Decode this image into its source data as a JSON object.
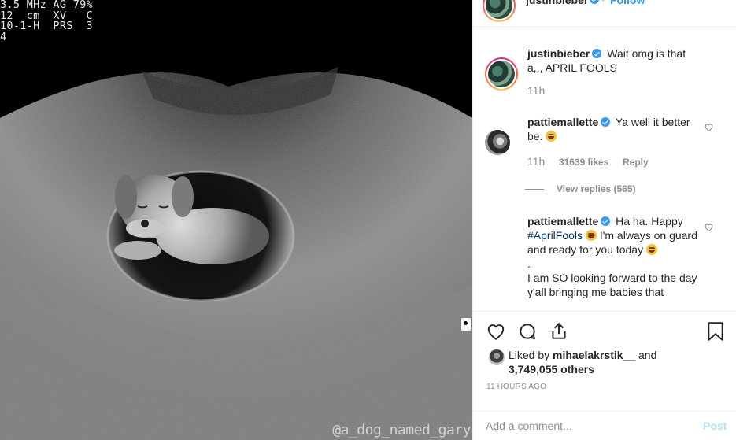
{
  "media": {
    "readout": "3.5 MHz AG 79%\n12  cm  XV   C\n10-1-H  PRS  3\n4",
    "watermark": "@a_dog_named_gary"
  },
  "header": {
    "username": "justinbieber",
    "dot": "•",
    "follow_label": "Follow"
  },
  "comments": [
    {
      "username": "justinbieber",
      "text": "Wait omg is that a,,, APRIL FOOLS",
      "time": "11h"
    },
    {
      "username": "pattiemallette",
      "text": "Ya well it better be.",
      "time": "11h",
      "likes": "31639 likes",
      "reply_label": "Reply",
      "view_replies": "View replies (565)"
    },
    {
      "username": "pattiemallette",
      "text_a": "Ha ha. Happy",
      "hashtag": "#AprilFools",
      "text_b": "I'm always on guard and ready for you today",
      "text_c": ".",
      "text_d": "I am SO looking forward to the day y'all bringing me babies that"
    }
  ],
  "likes": {
    "prefix": "Liked by",
    "user": "mihaelakrstik__",
    "and": "and",
    "count": "3,749,055 others"
  },
  "timestamp": "11 HOURS AGO",
  "add_comment": {
    "placeholder": "Add a comment...",
    "post_label": "Post"
  },
  "colors": {
    "accent": "#3897f0",
    "post_disabled": "#b2dffc",
    "hashtag": "#003569",
    "muted": "#8e8e8e"
  },
  "icons": [
    "heart-icon",
    "comment-icon",
    "share-icon",
    "bookmark-icon",
    "verified-badge-icon"
  ]
}
